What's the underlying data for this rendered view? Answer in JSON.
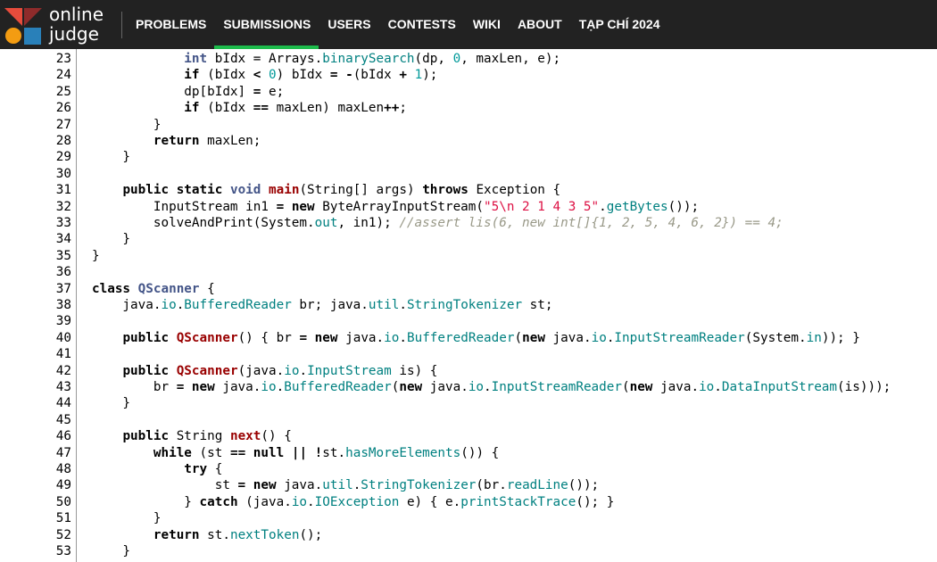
{
  "brand": {
    "line1": "online",
    "line2": "judge",
    "colors": [
      "#e74c3c",
      "#f39c12",
      "#2980b9",
      "#c0392b"
    ]
  },
  "nav": {
    "items": [
      "PROBLEMS",
      "SUBMISSIONS",
      "USERS",
      "CONTESTS",
      "WIKI",
      "ABOUT",
      "TẠP CHÍ 2024"
    ],
    "active": "SUBMISSIONS",
    "accent": "#1dbb4b"
  },
  "code": {
    "lines": [
      {
        "n": "23",
        "t": [
          [
            "            ",
            ""
          ],
          [
            "int",
            "kt"
          ],
          [
            " bIdx = Arrays.",
            ""
          ],
          [
            "binarySearch",
            "m"
          ],
          [
            "(dp, ",
            ""
          ],
          [
            "0",
            "n"
          ],
          [
            ", maxLen, e);",
            ""
          ]
        ]
      },
      {
        "n": "24",
        "t": [
          [
            "            ",
            ""
          ],
          [
            "if",
            "k"
          ],
          [
            " (bIdx ",
            ""
          ],
          [
            "<",
            "k"
          ],
          [
            " ",
            ""
          ],
          [
            "0",
            "n"
          ],
          [
            ") bIdx ",
            ""
          ],
          [
            "=",
            "k"
          ],
          [
            " ",
            ""
          ],
          [
            "-",
            "k"
          ],
          [
            "(bIdx ",
            ""
          ],
          [
            "+",
            "k"
          ],
          [
            " ",
            ""
          ],
          [
            "1",
            "n"
          ],
          [
            ");",
            ""
          ]
        ]
      },
      {
        "n": "25",
        "t": [
          [
            "            dp[bIdx] ",
            ""
          ],
          [
            "=",
            "k"
          ],
          [
            " e;",
            ""
          ]
        ]
      },
      {
        "n": "26",
        "t": [
          [
            "            ",
            ""
          ],
          [
            "if",
            "k"
          ],
          [
            " (bIdx ",
            ""
          ],
          [
            "==",
            "k"
          ],
          [
            " maxLen) maxLen",
            ""
          ],
          [
            "++",
            "k"
          ],
          [
            ";",
            ""
          ]
        ]
      },
      {
        "n": "27",
        "t": [
          [
            "        }",
            ""
          ]
        ]
      },
      {
        "n": "28",
        "t": [
          [
            "        ",
            ""
          ],
          [
            "return",
            "k"
          ],
          [
            " maxLen;",
            ""
          ]
        ]
      },
      {
        "n": "29",
        "t": [
          [
            "    }",
            ""
          ]
        ]
      },
      {
        "n": "30",
        "t": [
          [
            "",
            ""
          ]
        ]
      },
      {
        "n": "31",
        "t": [
          [
            "    ",
            ""
          ],
          [
            "public",
            "k"
          ],
          [
            " ",
            ""
          ],
          [
            "static",
            "k"
          ],
          [
            " ",
            ""
          ],
          [
            "void",
            "kt"
          ],
          [
            " ",
            ""
          ],
          [
            "main",
            "f"
          ],
          [
            "(String[] args) ",
            ""
          ],
          [
            "throws",
            "k"
          ],
          [
            " Exception {",
            ""
          ]
        ]
      },
      {
        "n": "32",
        "t": [
          [
            "        InputStream in1 ",
            ""
          ],
          [
            "=",
            "k"
          ],
          [
            " ",
            ""
          ],
          [
            "new",
            "k"
          ],
          [
            " ByteArrayInputStream(",
            ""
          ],
          [
            "\"5\\n 2 1 4 3 5\"",
            "s"
          ],
          [
            ".",
            ""
          ],
          [
            "getBytes",
            "m"
          ],
          [
            "());",
            ""
          ]
        ]
      },
      {
        "n": "33",
        "t": [
          [
            "        solveAndPrint(System.",
            ""
          ],
          [
            "out",
            "m"
          ],
          [
            ", in1); ",
            ""
          ],
          [
            "//assert lis(6, new int[]{1, 2, 5, 4, 6, 2}) == 4;",
            "c"
          ]
        ]
      },
      {
        "n": "34",
        "t": [
          [
            "    }",
            ""
          ]
        ]
      },
      {
        "n": "35",
        "t": [
          [
            "}",
            ""
          ]
        ]
      },
      {
        "n": "36",
        "t": [
          [
            "",
            ""
          ]
        ]
      },
      {
        "n": "37",
        "t": [
          [
            "class",
            "k"
          ],
          [
            " ",
            ""
          ],
          [
            "QScanner",
            "kt"
          ],
          [
            " {",
            ""
          ]
        ]
      },
      {
        "n": "38",
        "t": [
          [
            "    java.",
            ""
          ],
          [
            "io",
            "m"
          ],
          [
            ".",
            ""
          ],
          [
            "BufferedReader",
            "m"
          ],
          [
            " br; java.",
            ""
          ],
          [
            "util",
            "m"
          ],
          [
            ".",
            ""
          ],
          [
            "StringTokenizer",
            "m"
          ],
          [
            " st;",
            ""
          ]
        ]
      },
      {
        "n": "39",
        "t": [
          [
            "",
            ""
          ]
        ]
      },
      {
        "n": "40",
        "t": [
          [
            "    ",
            ""
          ],
          [
            "public",
            "k"
          ],
          [
            " ",
            ""
          ],
          [
            "QScanner",
            "f"
          ],
          [
            "() { br ",
            ""
          ],
          [
            "=",
            "k"
          ],
          [
            " ",
            ""
          ],
          [
            "new",
            "k"
          ],
          [
            " java.",
            ""
          ],
          [
            "io",
            "m"
          ],
          [
            ".",
            ""
          ],
          [
            "BufferedReader",
            "m"
          ],
          [
            "(",
            ""
          ],
          [
            "new",
            "k"
          ],
          [
            " java.",
            ""
          ],
          [
            "io",
            "m"
          ],
          [
            ".",
            ""
          ],
          [
            "InputStreamReader",
            "m"
          ],
          [
            "(System.",
            ""
          ],
          [
            "in",
            "m"
          ],
          [
            ")); }",
            ""
          ]
        ]
      },
      {
        "n": "41",
        "t": [
          [
            "",
            ""
          ]
        ]
      },
      {
        "n": "42",
        "t": [
          [
            "    ",
            ""
          ],
          [
            "public",
            "k"
          ],
          [
            " ",
            ""
          ],
          [
            "QScanner",
            "f"
          ],
          [
            "(java.",
            ""
          ],
          [
            "io",
            "m"
          ],
          [
            ".",
            ""
          ],
          [
            "InputStream",
            "m"
          ],
          [
            " is) {",
            ""
          ]
        ]
      },
      {
        "n": "43",
        "t": [
          [
            "        br ",
            ""
          ],
          [
            "=",
            "k"
          ],
          [
            " ",
            ""
          ],
          [
            "new",
            "k"
          ],
          [
            " java.",
            ""
          ],
          [
            "io",
            "m"
          ],
          [
            ".",
            ""
          ],
          [
            "BufferedReader",
            "m"
          ],
          [
            "(",
            ""
          ],
          [
            "new",
            "k"
          ],
          [
            " java.",
            ""
          ],
          [
            "io",
            "m"
          ],
          [
            ".",
            ""
          ],
          [
            "InputStreamReader",
            "m"
          ],
          [
            "(",
            ""
          ],
          [
            "new",
            "k"
          ],
          [
            " java.",
            ""
          ],
          [
            "io",
            "m"
          ],
          [
            ".",
            ""
          ],
          [
            "DataInputStream",
            "m"
          ],
          [
            "(is)));",
            ""
          ]
        ]
      },
      {
        "n": "44",
        "t": [
          [
            "    }",
            ""
          ]
        ]
      },
      {
        "n": "45",
        "t": [
          [
            "",
            ""
          ]
        ]
      },
      {
        "n": "46",
        "t": [
          [
            "    ",
            ""
          ],
          [
            "public",
            "k"
          ],
          [
            " String ",
            ""
          ],
          [
            "next",
            "f"
          ],
          [
            "() {",
            ""
          ]
        ]
      },
      {
        "n": "47",
        "t": [
          [
            "        ",
            ""
          ],
          [
            "while",
            "k"
          ],
          [
            " (st ",
            ""
          ],
          [
            "==",
            "k"
          ],
          [
            " ",
            ""
          ],
          [
            "null",
            "k"
          ],
          [
            " ",
            ""
          ],
          [
            "||",
            "k"
          ],
          [
            " ",
            ""
          ],
          [
            "!",
            "k"
          ],
          [
            "st.",
            ""
          ],
          [
            "hasMoreElements",
            "m"
          ],
          [
            "()) {",
            ""
          ]
        ]
      },
      {
        "n": "48",
        "t": [
          [
            "            ",
            ""
          ],
          [
            "try",
            "k"
          ],
          [
            " {",
            ""
          ]
        ]
      },
      {
        "n": "49",
        "t": [
          [
            "                st ",
            ""
          ],
          [
            "=",
            "k"
          ],
          [
            " ",
            ""
          ],
          [
            "new",
            "k"
          ],
          [
            " java.",
            ""
          ],
          [
            "util",
            "m"
          ],
          [
            ".",
            ""
          ],
          [
            "StringTokenizer",
            "m"
          ],
          [
            "(br.",
            ""
          ],
          [
            "readLine",
            "m"
          ],
          [
            "());",
            ""
          ]
        ]
      },
      {
        "n": "50",
        "t": [
          [
            "            } ",
            ""
          ],
          [
            "catch",
            "k"
          ],
          [
            " (java.",
            ""
          ],
          [
            "io",
            "m"
          ],
          [
            ".",
            ""
          ],
          [
            "IOException",
            "m"
          ],
          [
            " e) { e.",
            ""
          ],
          [
            "printStackTrace",
            "m"
          ],
          [
            "(); }",
            ""
          ]
        ]
      },
      {
        "n": "51",
        "t": [
          [
            "        }",
            ""
          ]
        ]
      },
      {
        "n": "52",
        "t": [
          [
            "        ",
            ""
          ],
          [
            "return",
            "k"
          ],
          [
            " st.",
            ""
          ],
          [
            "nextToken",
            "m"
          ],
          [
            "();",
            ""
          ]
        ]
      },
      {
        "n": "53",
        "t": [
          [
            "    }",
            ""
          ]
        ]
      }
    ]
  }
}
